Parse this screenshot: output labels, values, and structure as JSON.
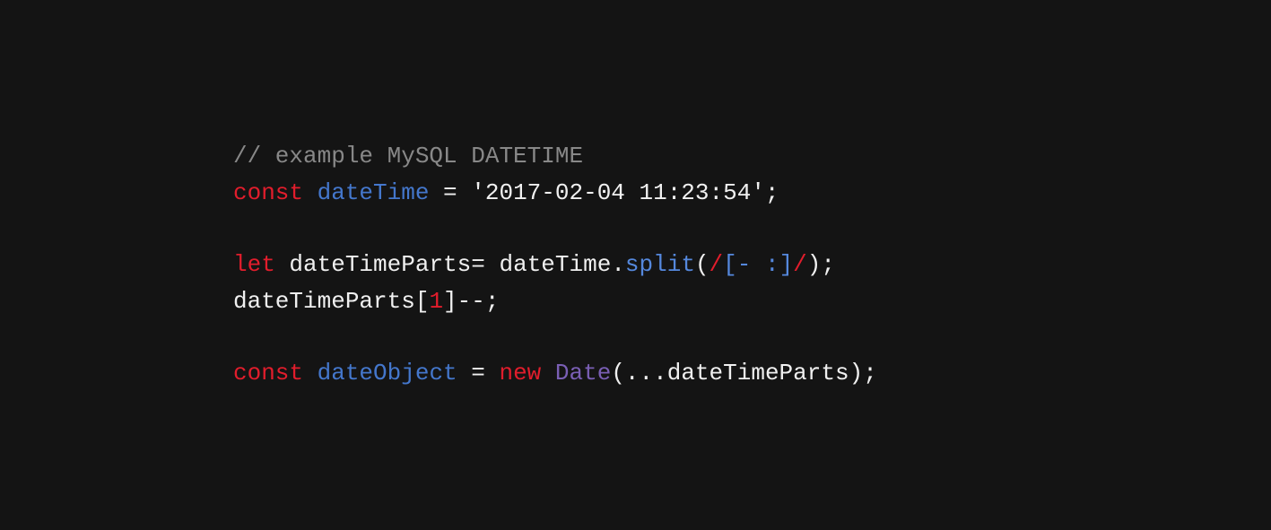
{
  "code": {
    "line1": {
      "comment": "// example MySQL DATETIME"
    },
    "line2": {
      "kw_const": "const",
      "var_dateTime": "dateTime",
      "eq": " = ",
      "str_value": "'2017-02-04 11:23:54'",
      "semi": ";"
    },
    "line3": {
      "blank": ""
    },
    "line4": {
      "kw_let": "let",
      "var_dateTimeParts": "dateTimeParts",
      "eq": "= ",
      "obj": "dateTime",
      "dot": ".",
      "method": "split",
      "open": "(",
      "regex_slash1": "/",
      "regex_class": "[- :]",
      "regex_slash2": "/",
      "close": ")",
      "semi": ";"
    },
    "line5": {
      "text_a": "dateTimeParts[",
      "num": "1",
      "text_b": "]--;"
    },
    "line6": {
      "blank": ""
    },
    "line7": {
      "kw_const": "const",
      "var_dateObject": "dateObject",
      "eq": " = ",
      "kw_new": "new",
      "class_Date": "Date",
      "open": "(",
      "spread": "...",
      "arg": "dateTimeParts",
      "close": ")",
      "semi": ";"
    }
  }
}
